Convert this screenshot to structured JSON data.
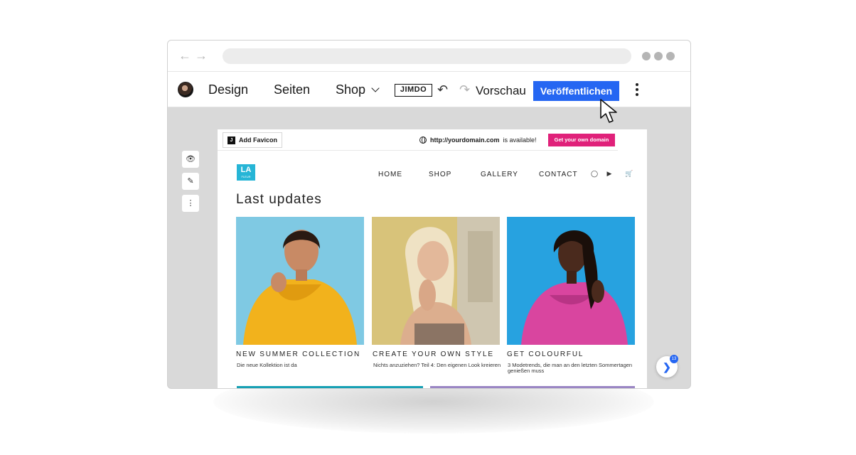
{
  "editor": {
    "menu": [
      "Design",
      "Seiten",
      "Shop"
    ],
    "logo": "JIMDO",
    "preview_label": "Vorschau",
    "publish_label": "Veröffentlichen"
  },
  "domain_bar": {
    "favicon_label": "Add Favicon",
    "domain": "http://yourdomain.com",
    "available_text": "is available!",
    "cta_label": "Get your own domain"
  },
  "site": {
    "logo_text": "LA",
    "logo_sub": "FLEUR",
    "nav": [
      "HOME",
      "SHOP",
      "GALLERY",
      "CONTACT"
    ],
    "section_title": "Last updates",
    "cards": [
      {
        "title": "NEW SUMMER COLLECTION",
        "text": "Die neue Kollektion ist da"
      },
      {
        "title": "CREATE YOUR OWN STYLE",
        "text": "Nichts anzuziehen? Teil 4: Den eigenen Look kreieren"
      },
      {
        "title": "GET COLOURFUL",
        "text": "3 Modetrends, die man an den letzten Sommertagen genießen muss"
      }
    ]
  },
  "chat_badge": "13",
  "colors": {
    "publish": "#2566f2",
    "cta": "#e0217a",
    "logo_bg": "#26b5d6"
  }
}
